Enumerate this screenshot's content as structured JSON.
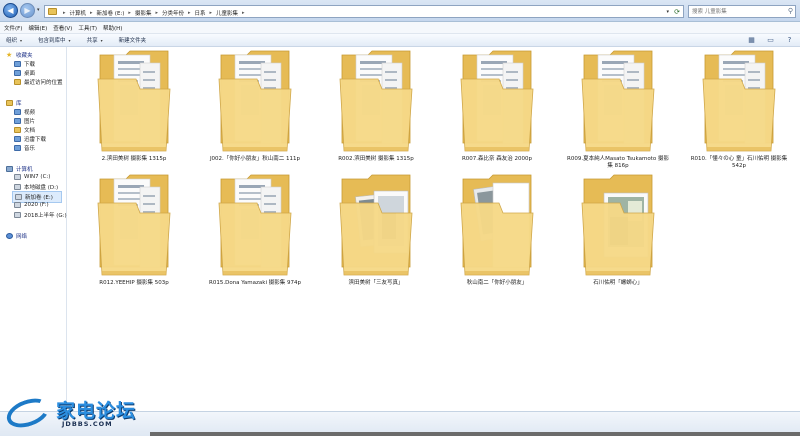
{
  "address_bar": {
    "breadcrumbs": [
      "计算机",
      "新加卷 (E:)",
      "摄影集",
      "分类年份",
      "日系",
      "儿童影集"
    ],
    "search_placeholder": "搜索 儿童影集"
  },
  "menu": [
    "文件(F)",
    "编辑(E)",
    "查看(V)",
    "工具(T)",
    "帮助(H)"
  ],
  "toolbar": {
    "organize": "组织",
    "include_in_library": "包含到库中",
    "share": "共享",
    "new_folder": "新建文件夹"
  },
  "sidebar": {
    "favorites": {
      "header": "收藏夹",
      "items": [
        "下载",
        "桌面",
        "最近访问的位置"
      ]
    },
    "libraries": {
      "header": "库",
      "items": [
        "视频",
        "图片",
        "文档",
        "迅雷下载",
        "音乐"
      ]
    },
    "computer": {
      "header": "计算机",
      "items": [
        "WIN7 (C:)",
        "本地磁盘 (D:)",
        "新加卷 (E:)",
        "2020 (F:)",
        "2018上半年 (G:)"
      ],
      "selected": "新加卷 (E:)"
    },
    "network": {
      "header": "网络"
    }
  },
  "folders": [
    {
      "name": "2.滨田美树 摄影集 1315p",
      "style": "docs"
    },
    {
      "name": "J002.「你好小朋友」秋山南二 111p",
      "style": "docs"
    },
    {
      "name": "R002.滨田美树 摄影集 1315p",
      "style": "docs"
    },
    {
      "name": "R007.森比奈 森友治 2000p",
      "style": "docs"
    },
    {
      "name": "R009.夏本純人Masato Tsukamoto 摄影集 816p",
      "style": "docs"
    },
    {
      "name": "R010.「懂々の心 童」石川佑明 摄影集 542p",
      "style": "docs"
    },
    {
      "name": "R012.YEEHIP 摄影集 503p",
      "style": "docs"
    },
    {
      "name": "R015.Dona Yamazaki 摄影集 974p",
      "style": "docs"
    },
    {
      "name": "滨田美树「三友写真」",
      "style": "photos"
    },
    {
      "name": "秋山南二「你好小朋友」",
      "style": "blank"
    },
    {
      "name": "石川佑明「螺蛳心」",
      "style": "photo2"
    }
  ],
  "watermark": {
    "text": "家电论坛",
    "sub": "JDBBS.COM"
  },
  "colors": {
    "folder": "#f3d27a",
    "folder_dark": "#d9a93c",
    "selection": "#dcebfc"
  }
}
